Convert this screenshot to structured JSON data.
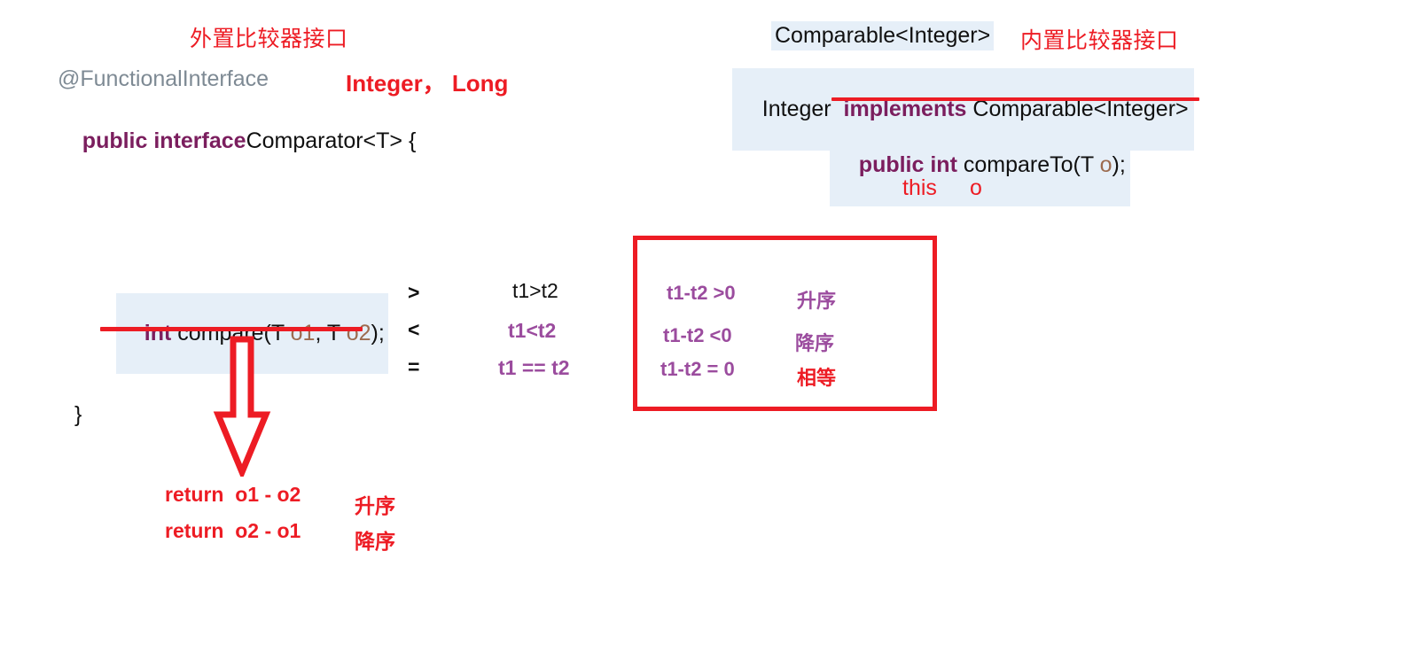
{
  "slide": {
    "left_panel": {
      "heading_cn": "外置比较器接口",
      "annotation": "@FunctionalInterface",
      "types_note": "Integer， Long",
      "decl_kw": "public interface",
      "decl_rest": "Comparator<T> {",
      "method_kw": "int",
      "method_rest_a": " compare(T ",
      "method_o1": "o1",
      "method_rest_b": ", T ",
      "method_o2": "o2",
      "method_rest_c": ");",
      "closing_brace": "}",
      "returns": [
        {
          "code": "return  o1 - o2",
          "order": "升序"
        },
        {
          "code": "return  o2 - o1",
          "order": "降序"
        }
      ]
    },
    "operators": {
      "rows": [
        {
          "symbol": ">",
          "expr": "t1>t2",
          "expr_color": "black"
        },
        {
          "symbol": "<",
          "expr": "t1<t2",
          "expr_color": "purple"
        },
        {
          "symbol": "=",
          "expr": "t1 == t2",
          "expr_color": "purple"
        }
      ]
    },
    "result_box": {
      "rows": [
        {
          "expr": "t1-t2 >0",
          "order": "升序",
          "order_color": "purple"
        },
        {
          "expr": "t1-t2 <0",
          "order": "降序",
          "order_color": "purple"
        },
        {
          "expr": "t1-t2 = 0",
          "order": "相等",
          "order_color": "red"
        }
      ]
    },
    "right_panel": {
      "type_chip": "Comparable<Integer>",
      "heading_cn": "内置比较器接口",
      "impl_a": "Integer  ",
      "impl_kw": "implements",
      "impl_b": " Comparable<Integer>",
      "method_kw": "public int",
      "method_rest_a": " compareTo(T ",
      "method_o": "o",
      "method_rest_b": ");",
      "this_label": "this",
      "o_label": "o"
    }
  },
  "colors": {
    "red": "#ED1C24",
    "purple": "#9B4C9E",
    "dark_purple": "#7B1E5E",
    "highlight": "#E6EFF8",
    "gray": "#7E8A94",
    "tan": "#9C6B4F"
  }
}
